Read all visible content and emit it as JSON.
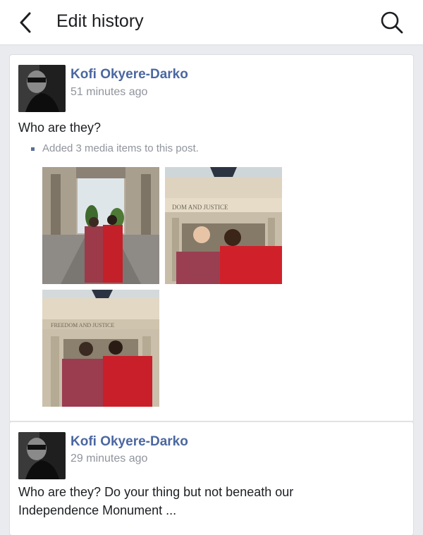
{
  "header": {
    "title": "Edit history",
    "back_icon": "chevron-left-icon",
    "search_icon": "search-icon"
  },
  "revisions": [
    {
      "author": "Kofi Okyere-Darko",
      "time": "51 minutes ago",
      "text": "Who are they?",
      "edit_note": "Added 3 media items to this post.",
      "media_count": 3
    },
    {
      "author": "Kofi Okyere-Darko",
      "time": "29 minutes ago",
      "text": "Who are they? Do your thing but not beneath our Independence Monument ..."
    }
  ],
  "colors": {
    "author_link": "#4b67a1",
    "muted": "#90949c",
    "background": "#e9ebee"
  }
}
